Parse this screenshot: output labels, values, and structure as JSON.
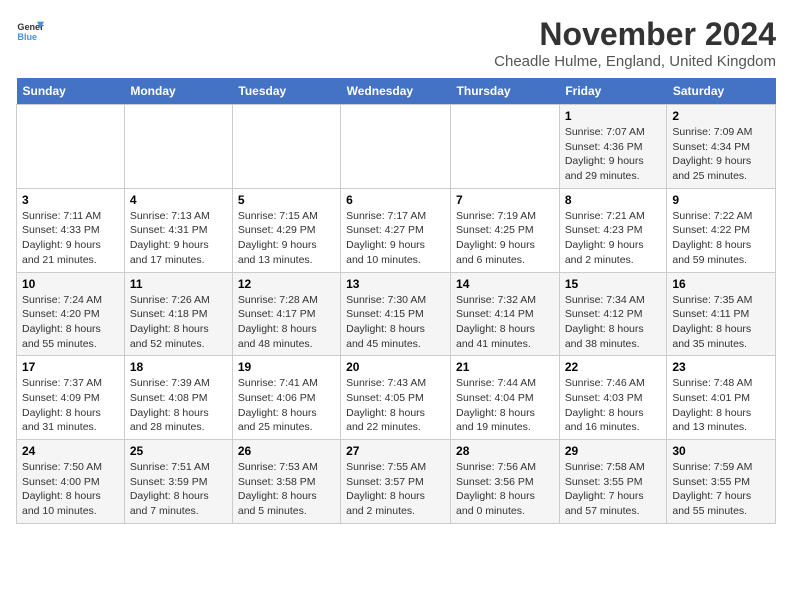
{
  "logo": {
    "line1": "General",
    "line2": "Blue"
  },
  "title": "November 2024",
  "subtitle": "Cheadle Hulme, England, United Kingdom",
  "days_of_week": [
    "Sunday",
    "Monday",
    "Tuesday",
    "Wednesday",
    "Thursday",
    "Friday",
    "Saturday"
  ],
  "weeks": [
    [
      {
        "day": "",
        "content": ""
      },
      {
        "day": "",
        "content": ""
      },
      {
        "day": "",
        "content": ""
      },
      {
        "day": "",
        "content": ""
      },
      {
        "day": "",
        "content": ""
      },
      {
        "day": "1",
        "content": "Sunrise: 7:07 AM\nSunset: 4:36 PM\nDaylight: 9 hours and 29 minutes."
      },
      {
        "day": "2",
        "content": "Sunrise: 7:09 AM\nSunset: 4:34 PM\nDaylight: 9 hours and 25 minutes."
      }
    ],
    [
      {
        "day": "3",
        "content": "Sunrise: 7:11 AM\nSunset: 4:33 PM\nDaylight: 9 hours and 21 minutes."
      },
      {
        "day": "4",
        "content": "Sunrise: 7:13 AM\nSunset: 4:31 PM\nDaylight: 9 hours and 17 minutes."
      },
      {
        "day": "5",
        "content": "Sunrise: 7:15 AM\nSunset: 4:29 PM\nDaylight: 9 hours and 13 minutes."
      },
      {
        "day": "6",
        "content": "Sunrise: 7:17 AM\nSunset: 4:27 PM\nDaylight: 9 hours and 10 minutes."
      },
      {
        "day": "7",
        "content": "Sunrise: 7:19 AM\nSunset: 4:25 PM\nDaylight: 9 hours and 6 minutes."
      },
      {
        "day": "8",
        "content": "Sunrise: 7:21 AM\nSunset: 4:23 PM\nDaylight: 9 hours and 2 minutes."
      },
      {
        "day": "9",
        "content": "Sunrise: 7:22 AM\nSunset: 4:22 PM\nDaylight: 8 hours and 59 minutes."
      }
    ],
    [
      {
        "day": "10",
        "content": "Sunrise: 7:24 AM\nSunset: 4:20 PM\nDaylight: 8 hours and 55 minutes."
      },
      {
        "day": "11",
        "content": "Sunrise: 7:26 AM\nSunset: 4:18 PM\nDaylight: 8 hours and 52 minutes."
      },
      {
        "day": "12",
        "content": "Sunrise: 7:28 AM\nSunset: 4:17 PM\nDaylight: 8 hours and 48 minutes."
      },
      {
        "day": "13",
        "content": "Sunrise: 7:30 AM\nSunset: 4:15 PM\nDaylight: 8 hours and 45 minutes."
      },
      {
        "day": "14",
        "content": "Sunrise: 7:32 AM\nSunset: 4:14 PM\nDaylight: 8 hours and 41 minutes."
      },
      {
        "day": "15",
        "content": "Sunrise: 7:34 AM\nSunset: 4:12 PM\nDaylight: 8 hours and 38 minutes."
      },
      {
        "day": "16",
        "content": "Sunrise: 7:35 AM\nSunset: 4:11 PM\nDaylight: 8 hours and 35 minutes."
      }
    ],
    [
      {
        "day": "17",
        "content": "Sunrise: 7:37 AM\nSunset: 4:09 PM\nDaylight: 8 hours and 31 minutes."
      },
      {
        "day": "18",
        "content": "Sunrise: 7:39 AM\nSunset: 4:08 PM\nDaylight: 8 hours and 28 minutes."
      },
      {
        "day": "19",
        "content": "Sunrise: 7:41 AM\nSunset: 4:06 PM\nDaylight: 8 hours and 25 minutes."
      },
      {
        "day": "20",
        "content": "Sunrise: 7:43 AM\nSunset: 4:05 PM\nDaylight: 8 hours and 22 minutes."
      },
      {
        "day": "21",
        "content": "Sunrise: 7:44 AM\nSunset: 4:04 PM\nDaylight: 8 hours and 19 minutes."
      },
      {
        "day": "22",
        "content": "Sunrise: 7:46 AM\nSunset: 4:03 PM\nDaylight: 8 hours and 16 minutes."
      },
      {
        "day": "23",
        "content": "Sunrise: 7:48 AM\nSunset: 4:01 PM\nDaylight: 8 hours and 13 minutes."
      }
    ],
    [
      {
        "day": "24",
        "content": "Sunrise: 7:50 AM\nSunset: 4:00 PM\nDaylight: 8 hours and 10 minutes."
      },
      {
        "day": "25",
        "content": "Sunrise: 7:51 AM\nSunset: 3:59 PM\nDaylight: 8 hours and 7 minutes."
      },
      {
        "day": "26",
        "content": "Sunrise: 7:53 AM\nSunset: 3:58 PM\nDaylight: 8 hours and 5 minutes."
      },
      {
        "day": "27",
        "content": "Sunrise: 7:55 AM\nSunset: 3:57 PM\nDaylight: 8 hours and 2 minutes."
      },
      {
        "day": "28",
        "content": "Sunrise: 7:56 AM\nSunset: 3:56 PM\nDaylight: 8 hours and 0 minutes."
      },
      {
        "day": "29",
        "content": "Sunrise: 7:58 AM\nSunset: 3:55 PM\nDaylight: 7 hours and 57 minutes."
      },
      {
        "day": "30",
        "content": "Sunrise: 7:59 AM\nSunset: 3:55 PM\nDaylight: 7 hours and 55 minutes."
      }
    ]
  ]
}
